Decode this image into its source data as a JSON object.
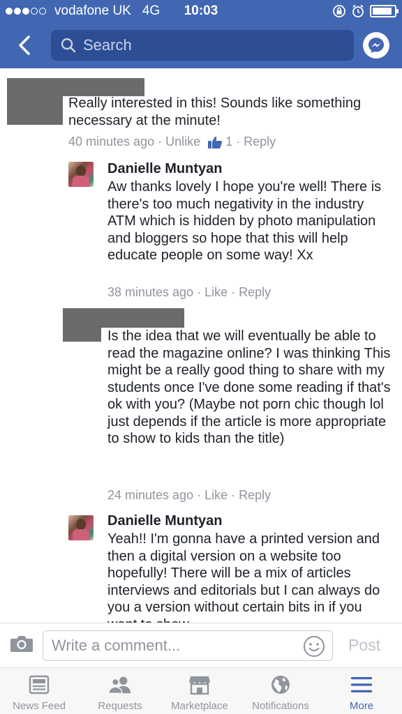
{
  "status_bar": {
    "carrier": "vodafone UK",
    "network": "4G",
    "time": "10:03",
    "signal_bars_filled": 3,
    "signal_bars_total": 5,
    "battery_level": 0.9
  },
  "header": {
    "search_placeholder": "Search",
    "back_icon": "back-chevron-icon",
    "messenger_icon": "messenger-icon",
    "accent_color": "#4267b2"
  },
  "comments": [
    {
      "author": "",
      "text": "Really interested in this! Sounds like something necessary at the minute!",
      "time": "40 minutes ago",
      "action": "Unlike",
      "likes": "1",
      "reply": "Reply"
    },
    {
      "author": "Danielle Muntyan",
      "text": "Aw thanks lovely I hope you're well! There is there's too much negativity in the industry ATM which is hidden by photo manipulation and bloggers so hope that this will help educate people on some way! Xx",
      "time": "38 minutes ago",
      "action": "Like",
      "reply": "Reply"
    },
    {
      "author": "",
      "text": "Is the idea that we will eventually be able to read the magazine online? I was thinking This might be a really good thing to share with my students once I've done some reading if that's ok with you? (Maybe not porn chic though lol just depends if the article is more appropriate to show to kids than the title)",
      "time": "24 minutes ago",
      "action": "Like",
      "reply": "Reply"
    },
    {
      "author": "Danielle Muntyan",
      "text": "Yeah!! I'm gonna have a printed version and then a digital version on a website too hopefully! There will be a mix of articles interviews and editorials but I can always do you a version without certain bits in if you want to show"
    }
  ],
  "composer": {
    "placeholder": "Write a comment...",
    "post_label": "Post"
  },
  "tabs": [
    {
      "label": "News Feed",
      "icon": "news-feed-icon",
      "active": false
    },
    {
      "label": "Requests",
      "icon": "friend-requests-icon",
      "active": false
    },
    {
      "label": "Marketplace",
      "icon": "marketplace-icon",
      "active": false
    },
    {
      "label": "Notifications",
      "icon": "globe-icon",
      "active": false
    },
    {
      "label": "More",
      "icon": "hamburger-menu-icon",
      "active": true
    }
  ]
}
